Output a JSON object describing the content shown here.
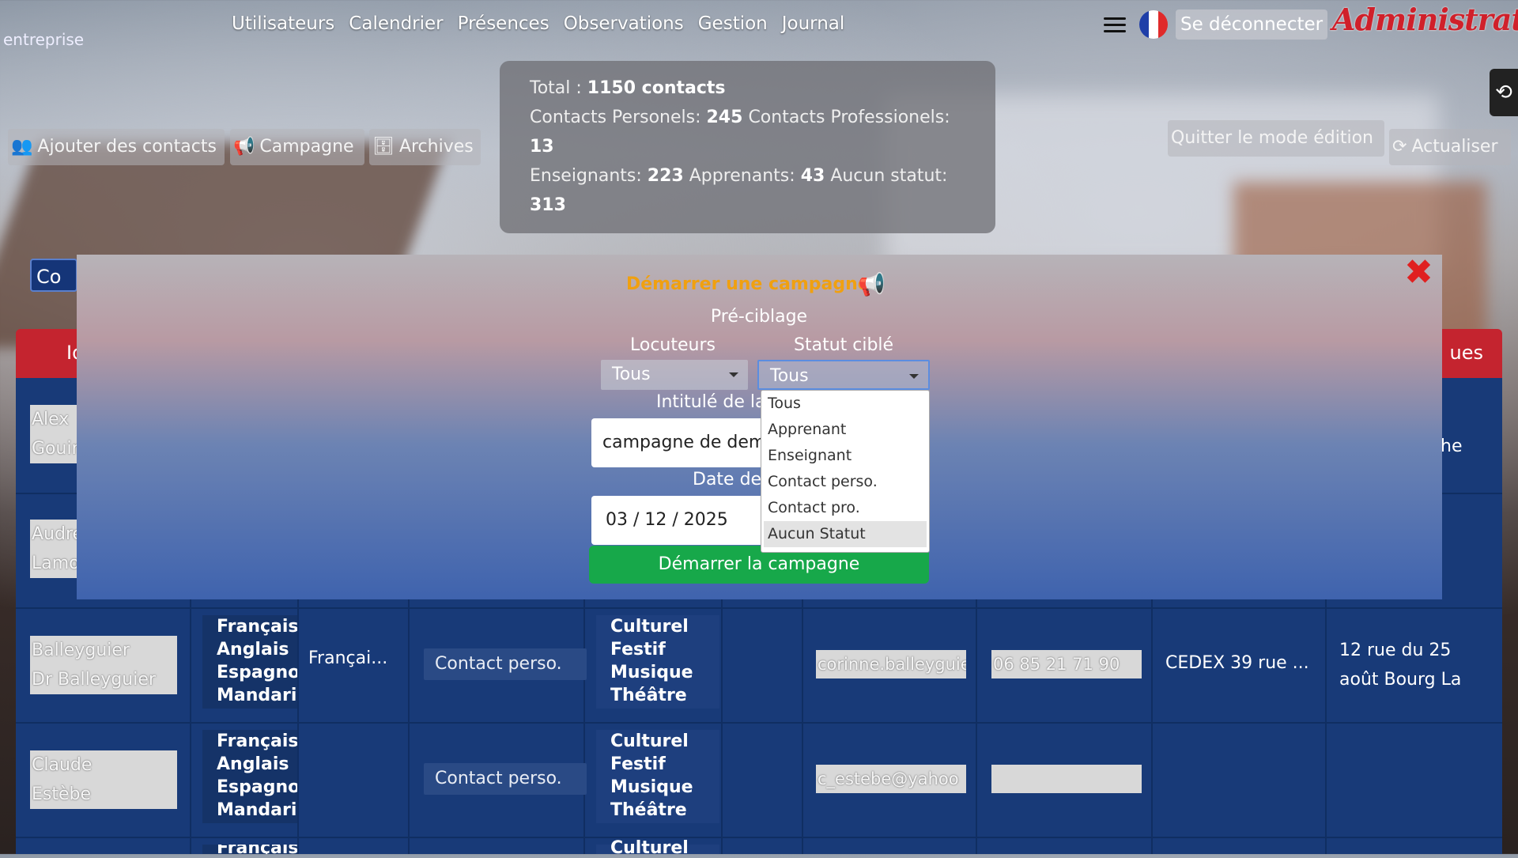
{
  "nav": {
    "company": "entreprise",
    "items": [
      "Utilisateurs",
      "Calendrier",
      "Présences",
      "Observations",
      "Gestion",
      "Journal"
    ],
    "logout": "Se déconnecter",
    "role": "Administrateur"
  },
  "stats": {
    "total_label": "Total :",
    "total_value": "1150 contacts",
    "perso_label": "Contacts Personels:",
    "perso_value": "245",
    "pro_label": "Contacts Professionels:",
    "pro_value": "13",
    "ens_label": "Enseignants:",
    "ens_value": "223",
    "app_label": "Apprenants:",
    "app_value": "43",
    "none_label": "Aucun statut:",
    "none_value": "313"
  },
  "actions": {
    "add": "Ajouter des contacts",
    "campaign": "Campagne",
    "archives": "Archives",
    "quit_edit": "Quitter le mode édition",
    "refresh": "Actualiser"
  },
  "contacts_tag": "Co",
  "table_header": {
    "left": "Id",
    "right": "ues"
  },
  "rows": [
    {
      "name1": "Alex",
      "name2": "Gouin",
      "right": "he"
    },
    {
      "name1": "Audrey",
      "name2": "Lamo"
    },
    {
      "name1": "Balleyguier",
      "name2": "Dr Balleyguier",
      "langs": [
        "Français",
        "Anglais",
        "Espagnol",
        "Mandarin"
      ],
      "lang_main": "Françai...",
      "status": "Contact perso.",
      "tags": [
        "Culturel",
        "Festif",
        "Musique",
        "Théâtre"
      ],
      "email": "corinne.balleyguier",
      "phone": "06  85 21 71 90",
      "city": "CEDEX 39 rue ...",
      "address": "12 rue du 25 août Bourg La"
    },
    {
      "name1": "Claude",
      "name2": "Estèbe",
      "langs": [
        "Français",
        "Anglais",
        "Espagnol",
        "Mandarin"
      ],
      "status": "Contact perso.",
      "tags": [
        "Culturel",
        "Festif",
        "Musique",
        "Théâtre"
      ],
      "email": "c_estebe@yahoo",
      "phone": ""
    },
    {
      "langs": [
        "Français"
      ],
      "tags": [
        "Culturel"
      ]
    }
  ],
  "modal": {
    "title": "Démarrer une campagne",
    "close_icon": "close-icon",
    "preciblage": "Pré-ciblage",
    "locuteurs_label": "Locuteurs",
    "locuteurs_value": "Tous",
    "statut_label": "Statut ciblé",
    "statut_value": "Tous",
    "intitule_label": "Intitulé de la",
    "intitule_value": "campagne de dem",
    "date_label": "Date de",
    "date_value": "03 / 12 / 2025",
    "start_button": "Démarrer la campagne"
  },
  "dropdown": {
    "options": [
      "Tous",
      "Apprenant",
      "Enseignant",
      "Contact perso.",
      "Contact pro.",
      "Aucun Statut"
    ],
    "highlighted": "Aucun Statut"
  },
  "colors": {
    "accent_red": "#c4242f",
    "table_blue": "#183a78",
    "start_green": "#17a84a",
    "title_orange": "#f0a010"
  }
}
